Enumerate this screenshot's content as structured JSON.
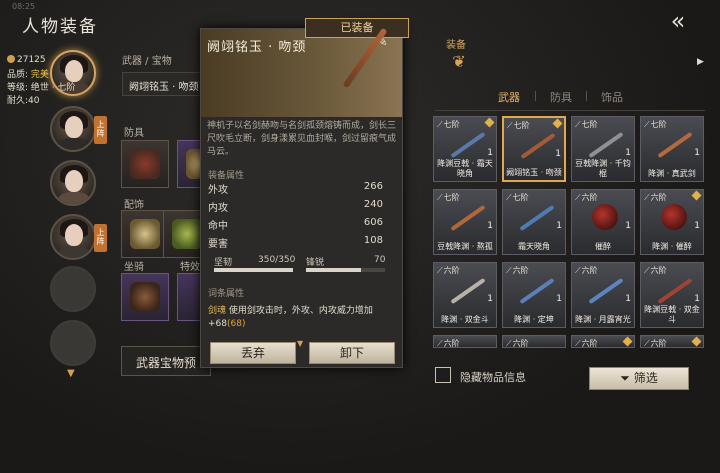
{
  "status": {
    "time": "08:25"
  },
  "page": {
    "title": "人物装备",
    "back_icon": "back-arrow-icon"
  },
  "characters": [
    {
      "name": "portrait-1",
      "active": true,
      "lineup": ""
    },
    {
      "name": "portrait-2",
      "active": false,
      "lineup": "上阵"
    },
    {
      "name": "portrait-3",
      "active": false,
      "lineup": ""
    },
    {
      "name": "portrait-4",
      "active": false,
      "lineup": "上阵"
    }
  ],
  "equip_panel": {
    "weapon_label": "武器 / 宝物",
    "weapon_slot_text": "阙翊铭玉 · 吻颈",
    "armor_label": "防具",
    "accessory_label": "配饰",
    "mount_label": "坐骑",
    "special_label": "特效",
    "bottom_button": "武器宝物预"
  },
  "tooltip": {
    "name": "阙翊铭玉 · 吻颈",
    "equipped_badge": "已装备",
    "price": "27125",
    "quality_label": "品质:",
    "quality_value": "完美",
    "grade_label": "等级:",
    "grade_value": "绝世 · 七阶",
    "durability_label": "耐久:",
    "durability_value": "40",
    "description": "神机子以名剑赫吻与名剑孤颈熔铸而成，剑长三尺吹毛立断，剑身漾累见血封喉，剑过留痕气成马云。",
    "attr_title": "装备属性",
    "stats": [
      {
        "label": "外攻",
        "value": "266"
      },
      {
        "label": "内攻",
        "value": "240"
      },
      {
        "label": "命中",
        "value": "606"
      },
      {
        "label": "要害",
        "value": "108"
      }
    ],
    "toughness_label": "坚韧",
    "toughness_value": "350/350",
    "toughness_fraction": 1.0,
    "sharp_label": "锋锐",
    "sharp_value": "70",
    "sharp_fraction": 0.7,
    "effect_title": "词条属性",
    "effect_key": "剑魂",
    "effect_text": "使用剑攻击时，外攻、内攻威力增加+68",
    "effect_highlight": "(68)",
    "discard_button": "丢弃",
    "unequip_button": "卸下"
  },
  "right_panel": {
    "header": "装备",
    "tabs": [
      "武器",
      "防具",
      "饰品"
    ],
    "active_tab": 0,
    "items": [
      {
        "tier": "七阶",
        "name": "降渊豆戟 · 霜天晓角",
        "count": "1",
        "mark": true,
        "color": "#5a79a8"
      },
      {
        "tier": "七阶",
        "name": "阙翊铭玉 · 吻颈",
        "count": "1",
        "mark": true,
        "color": "#a65a36",
        "selected": true
      },
      {
        "tier": "七阶",
        "name": "豆戟降渊 · 千钧棍",
        "count": "1",
        "mark": false,
        "color": "#8f8f97"
      },
      {
        "tier": "七阶",
        "name": "降渊 · 真武剑",
        "count": "1",
        "mark": false,
        "color": "#b56a3e"
      },
      {
        "tier": "七阶",
        "name": "豆戟降渊 · 熬孤",
        "count": "1",
        "mark": false,
        "color": "#b0673a"
      },
      {
        "tier": "七阶",
        "name": "霜天晓角",
        "count": "1",
        "mark": false,
        "color": "#4f7bb3"
      },
      {
        "tier": "六阶",
        "name": "催醉",
        "count": "1",
        "mark": false,
        "orb": true
      },
      {
        "tier": "六阶",
        "name": "降渊 · 催醉",
        "count": "1",
        "mark": true,
        "orb": true
      },
      {
        "tier": "六阶",
        "name": "降渊 · 双金斗",
        "count": "1",
        "mark": false,
        "color": "#b8b2a6"
      },
      {
        "tier": "六阶",
        "name": "降渊 · 定坤",
        "count": "1",
        "mark": false,
        "color": "#5b7fb6"
      },
      {
        "tier": "六阶",
        "name": "降渊 · 月露宵光",
        "count": "1",
        "mark": false,
        "color": "#5d84c2"
      },
      {
        "tier": "六阶",
        "name": "降渊豆戟 · 双金斗",
        "count": "1",
        "mark": false,
        "color": "#a04430"
      },
      {
        "tier": "六阶",
        "name": "",
        "count": "",
        "mark": false,
        "color": "#8f8a80"
      },
      {
        "tier": "六阶",
        "name": "",
        "count": "",
        "mark": false,
        "color": "#8f8a80"
      },
      {
        "tier": "六阶",
        "name": "",
        "count": "",
        "mark": true,
        "color": "#8f8a80"
      },
      {
        "tier": "六阶",
        "name": "",
        "count": "",
        "mark": true,
        "color": "#8f8a80"
      }
    ],
    "hide_label": "隐藏物品信息",
    "filter_button": "筛选"
  }
}
